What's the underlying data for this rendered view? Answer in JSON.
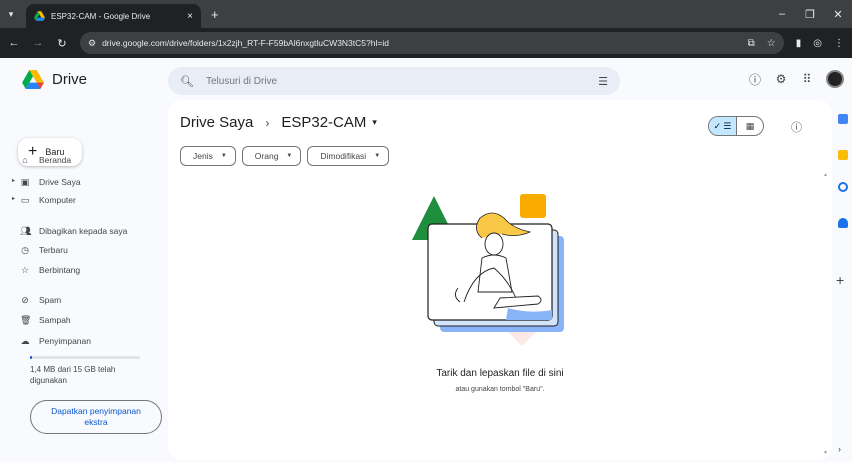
{
  "browser": {
    "tab_title": "ESP32-CAM - Google Drive",
    "tab_close": "×",
    "new_tab": "+",
    "url": "drive.google.com/drive/folders/1x2zjh_RT-F-F59bAl6nxgtluCW3N3tC5?hl=id"
  },
  "header": {
    "app_name": "Drive",
    "search_placeholder": "Telusuri di Drive"
  },
  "sidebar": {
    "new_label": "Baru",
    "items": [
      {
        "label": "Beranda",
        "icon": "home-icon"
      },
      {
        "label": "Drive Saya",
        "icon": "my-drive-icon"
      },
      {
        "label": "Komputer",
        "icon": "computer-icon"
      },
      {
        "label": "Dibagikan kepada saya",
        "icon": "shared-icon"
      },
      {
        "label": "Terbaru",
        "icon": "clock-icon"
      },
      {
        "label": "Berbintang",
        "icon": "star-icon"
      },
      {
        "label": "Spam",
        "icon": "spam-icon"
      },
      {
        "label": "Sampah",
        "icon": "trash-icon"
      },
      {
        "label": "Penyimpanan",
        "icon": "cloud-icon"
      }
    ],
    "storage_text": "1,4 MB dari 15 GB telah digunakan",
    "storage_used_fraction": 0.0001,
    "get_storage_label": "Dapatkan penyimpanan ekstra"
  },
  "main": {
    "breadcrumb": [
      "Drive Saya",
      "ESP32-CAM"
    ],
    "breadcrumb_separator": "›",
    "filters": [
      "Jenis",
      "Orang",
      "Dimodifikasi"
    ],
    "empty_title": "Tarik dan lepaskan file di sini",
    "empty_subtitle": "atau gunakan tombol \"Baru\"."
  },
  "colors": {
    "accent": "#0b57d0",
    "selected_view": "#c2e7ff",
    "panel_bg": "#f8fafd"
  }
}
